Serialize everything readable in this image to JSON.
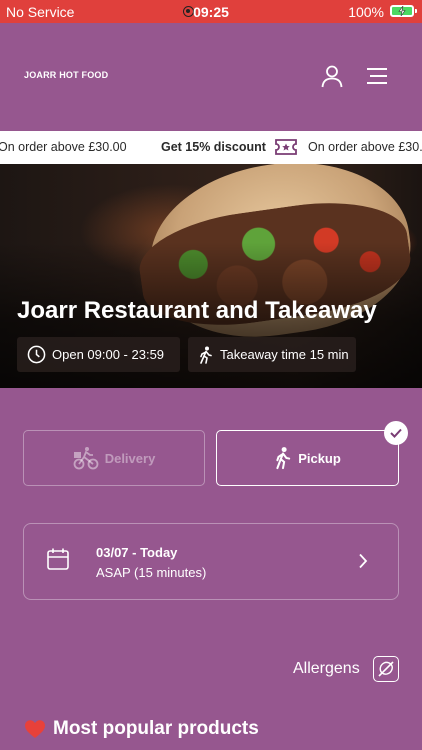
{
  "status_bar": {
    "carrier": "No Service",
    "time": "09:25",
    "battery": "100%"
  },
  "header": {
    "logo": "JOARR HOT FOOD"
  },
  "promo": {
    "left_text": "On order above £30.00",
    "discount": "Get 15% discount",
    "right_text": "On order above £30.00"
  },
  "hero": {
    "title": "Joarr Restaurant and Takeaway",
    "opening": "Open 09:00 - 23:59",
    "takeaway": "Takeaway time 15 min"
  },
  "order_mode": {
    "delivery_label": "Delivery",
    "pickup_label": "Pickup",
    "selected": "pickup"
  },
  "schedule": {
    "date": "03/07 - Today",
    "time": "ASAP (15 minutes)"
  },
  "allergens_label": "Allergens",
  "popular_title": "Most popular products",
  "colors": {
    "background": "#96578f",
    "status_bar": "#e0403c",
    "heart": "#e8413a"
  }
}
